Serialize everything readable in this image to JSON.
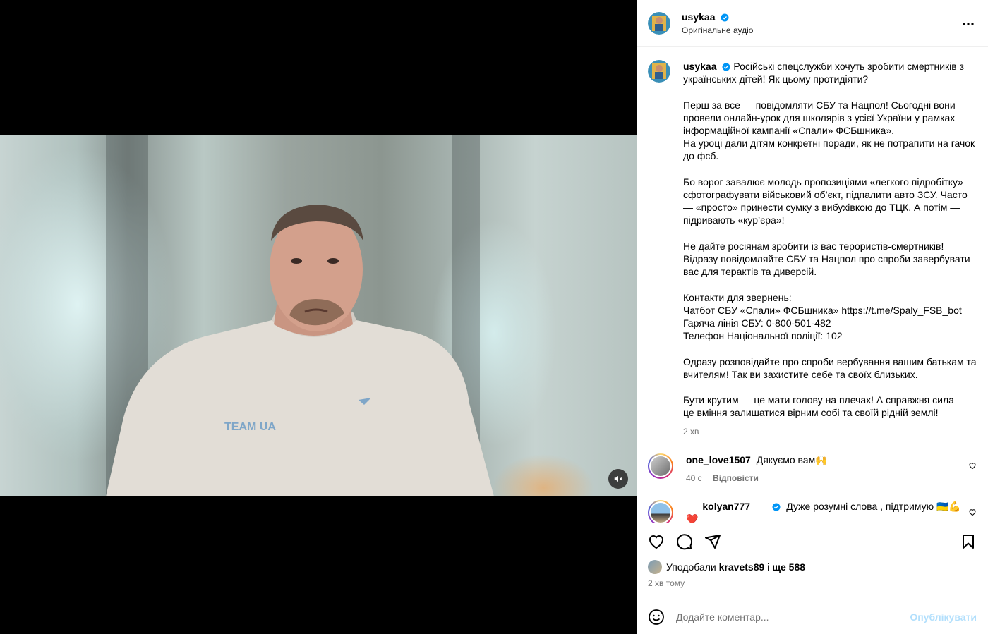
{
  "post": {
    "username": "usykaa",
    "audio": "Оригінальне аудіо",
    "more_icon": "more-horizontal-icon"
  },
  "caption": {
    "username": "usykaa",
    "paragraphs": [
      "Російські спецслужби хочуть зробити смертників з українських дітей! Як цьому протидіяти?",
      "Перш за все — повідомляти СБУ та Нацпол! Сьогодні вони провели онлайн-урок для школярів з усієї України у рамках інформаційної кампанії «Спали» ФСБшника».\nНа уроці дали дітям конкретні поради, як не потрапити на гачок до фсб.",
      "Бо ворог завалює молодь пропозиціями «легкого підробітку» — сфотографувати військовий об’єкт, підпалити авто ЗСУ. Часто — «просто» принести сумку з вибухівкою до ТЦК. А потім — підривають «кур’єра»!",
      "Не дайте росіянам зробити із вас терористів-смертників! Відразу повідомляйте СБУ та Нацпол про спроби завербувати вас для терактів та диверсій.",
      "Контакти для звернень:\nЧатбот СБУ «Спали» ФСБшника» https://t.me/Spaly_FSB_bot\nГаряча лінія СБУ: 0-800-501-482\nТелефон Національної поліції: 102",
      "Одразу розповідайте про спроби вербування вашим батькам та вчителям! Так ви захистите себе та своїх близьких.",
      "Бути крутим — це мати голову на плечах! А справжня сила — це вміння залишатися вірним собі та своїй рідній землі!"
    ],
    "time": "2 хв"
  },
  "comments": [
    {
      "username": "one_love1507",
      "text": "Дякуємо вам🙌",
      "time": "40 с",
      "reply": "Відповісти",
      "verified": false
    },
    {
      "username": "___kolyan777___",
      "text": "Дуже розумні слова , підтримую 🇺🇦💪❤️\n🇺🇦❤️🙏",
      "verified": true
    }
  ],
  "actions": {
    "liked_by_prefix": "Уподобали",
    "liked_by_user": "kravets89",
    "and": "і",
    "others": "ще 588",
    "time_ago": "2 хв тому"
  },
  "comment_box": {
    "placeholder": "Додайте коментар...",
    "publish": "Опублікувати"
  },
  "video": {
    "shirt_text": "TEAM UA",
    "muted": true
  }
}
